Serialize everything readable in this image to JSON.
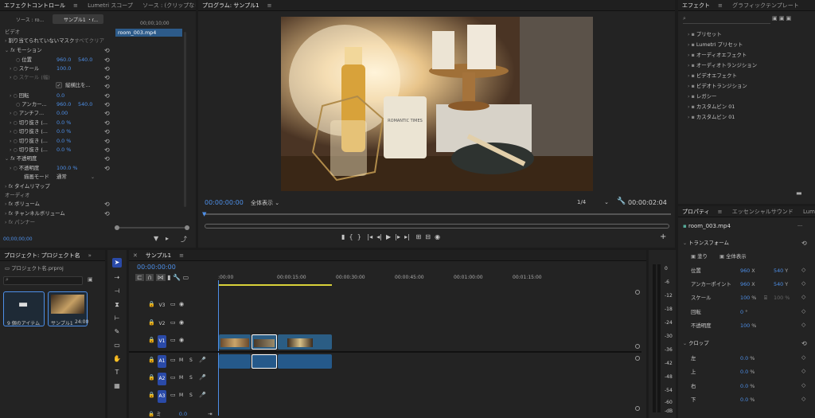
{
  "effect_controls": {
    "tabs": [
      "ソース : ro...",
      "サンプル1 ・r...",
      "エフェクトコントロール",
      "Lumetri スコープ",
      "ソース : (クリップなし)"
    ],
    "video_label": "ビデオ",
    "mask_label": "割り当てられていないマスク",
    "mask_action": "すべてクリア",
    "clip_chip": "room_003.mp4",
    "time_label": "00;00;10;00",
    "motion": "モーション",
    "rows": [
      {
        "name": "位置",
        "v1": "960.0",
        "v2": "540.0"
      },
      {
        "name": "スケール",
        "v1": "100.0",
        "v2": ""
      },
      {
        "name": "スケール (幅)",
        "v1": "",
        "v2": ""
      },
      {
        "name": "縦横比を...",
        "v1": "",
        "v2": ""
      },
      {
        "name": "回転",
        "v1": "0.0",
        "v2": ""
      },
      {
        "name": "アンカー...",
        "v1": "960.0",
        "v2": "540.0"
      },
      {
        "name": "アンチフ...",
        "v1": "0.00",
        "v2": ""
      },
      {
        "name": "切り抜き (...",
        "v1": "0.0 %",
        "v2": ""
      },
      {
        "name": "切り抜き (...",
        "v1": "0.0 %",
        "v2": ""
      },
      {
        "name": "切り抜き (...",
        "v1": "0.0 %",
        "v2": ""
      },
      {
        "name": "切り抜き (...",
        "v1": "0.0 %",
        "v2": ""
      }
    ],
    "opacity": "不透明度",
    "opacity_value_label": "不透明度",
    "opacity_value": "100.0 %",
    "blend_mode_label": "描画モード",
    "blend_mode_value": "通常",
    "time_remap": "タイムリマップ",
    "audio_label": "オーディオ",
    "volume": "ボリューム",
    "channel_volume": "チャンネルボリューム",
    "panner": "パンナー",
    "footer_time": "00;00;00;00"
  },
  "program": {
    "title": "プログラム: サンプル1",
    "timecode": "00:00:00:00",
    "fit": "全体表示",
    "resolution": "1/4",
    "duration": "00:00:02:04",
    "labels": {
      "bottle": "ROMANTIC TIMES"
    }
  },
  "effects": {
    "tabs": [
      "エフェクト",
      "グラフィックテンプレート"
    ],
    "items": [
      "プリセット",
      "Lumetri プリセット",
      "オーディオエフェクト",
      "オーディオトランジション",
      "ビデオエフェクト",
      "ビデオトランジション",
      "レガシー",
      "カスタムビン 01",
      "カスタムビン 01"
    ]
  },
  "properties": {
    "tabs": [
      "プロパティ",
      "エッセンシャルサウンド",
      "Lume"
    ],
    "clip": "room_003.mp4",
    "transform": "トランスフォーム",
    "fill_label": "塗り",
    "fit_label": "全体表示",
    "rows": [
      {
        "name": "位置",
        "v1": "960",
        "u1": "X",
        "v2": "540",
        "u2": "Y"
      },
      {
        "name": "アンカーポイント",
        "v1": "960",
        "u1": "X",
        "v2": "540",
        "u2": "Y"
      },
      {
        "name": "スケール",
        "v1": "100",
        "u1": "%",
        "v2": "100",
        "u2": "%"
      },
      {
        "name": "回転",
        "v1": "0",
        "u1": "°",
        "v2": "",
        "u2": ""
      },
      {
        "name": "不透明度",
        "v1": "100",
        "u1": "%",
        "v2": "",
        "u2": ""
      }
    ],
    "crop": "クロップ",
    "crop_rows": [
      {
        "name": "左",
        "v": "0.0",
        "u": "%"
      },
      {
        "name": "上",
        "v": "0.0",
        "u": "%"
      },
      {
        "name": "右",
        "v": "0.0",
        "u": "%"
      },
      {
        "name": "下",
        "v": "0.0",
        "u": "%"
      }
    ]
  },
  "project": {
    "title": "プロジェクト: プロジェクト名",
    "filename": "プロジェクト名.prproj",
    "items": [
      {
        "name": "9 個のアイテム",
        "duration": ""
      },
      {
        "name": "サンプル1",
        "duration": "24:00"
      }
    ]
  },
  "timeline": {
    "title": "サンプル1",
    "timecode": "00:00:00:00",
    "ruler": [
      ":00:00",
      "00:00:15:00",
      "00:00:30:00",
      "00:00:45:00",
      "00:01:00:00",
      "00:01:15:00"
    ],
    "video_tracks": [
      "V3",
      "V2",
      "V1"
    ],
    "audio_tracks": [
      "A1",
      "A2",
      "A3"
    ],
    "meter_scale": [
      "0",
      "-6",
      "-12",
      "-18",
      "-24",
      "-30",
      "-36",
      "-42",
      "-48",
      "-54",
      "-60",
      "-dB"
    ],
    "mix_label": "ミ",
    "mix_value": "0.0"
  }
}
